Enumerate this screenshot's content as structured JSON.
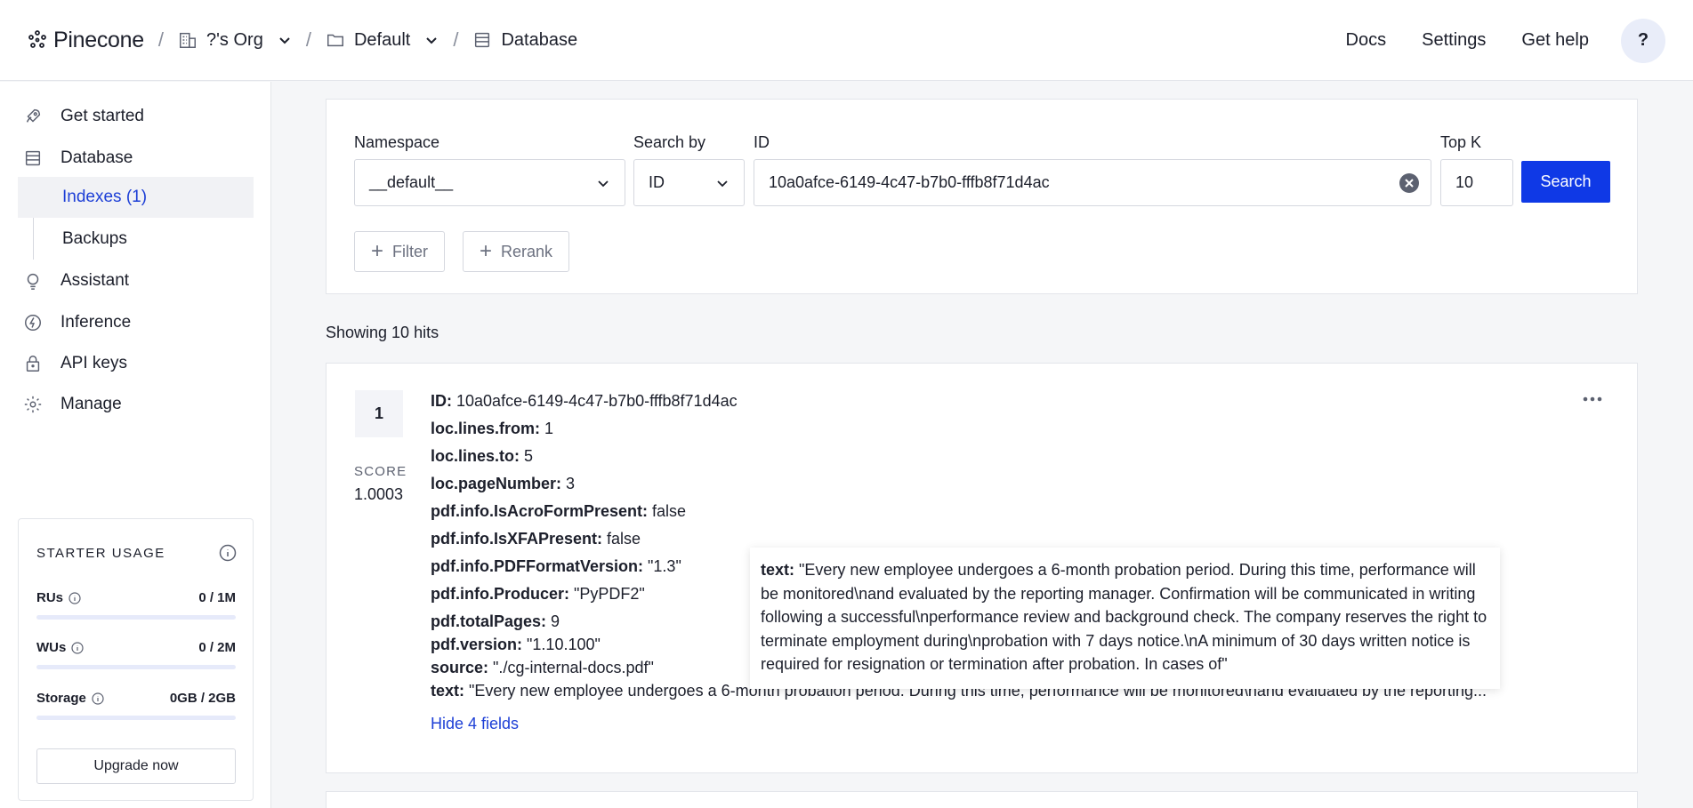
{
  "header": {
    "logo_text": "Pinecone",
    "breadcrumbs": [
      {
        "label": "?'s Org",
        "icon": "building-icon"
      },
      {
        "label": "Default",
        "icon": "folder-icon"
      },
      {
        "label": "Database",
        "icon": "database-icon"
      }
    ],
    "separator": "/",
    "nav": {
      "docs": "Docs",
      "settings": "Settings",
      "get_help": "Get help",
      "help_button": "?"
    }
  },
  "sidebar": {
    "items": [
      {
        "label": "Get started",
        "icon": "rocket-icon"
      },
      {
        "label": "Database",
        "icon": "database-icon"
      },
      {
        "label": "Assistant",
        "icon": "lightbulb-icon"
      },
      {
        "label": "Inference",
        "icon": "lightning-icon"
      },
      {
        "label": "API keys",
        "icon": "lock-icon"
      },
      {
        "label": "Manage",
        "icon": "gear-icon"
      }
    ],
    "sub_items": [
      {
        "label": "Indexes (1)",
        "active": true
      },
      {
        "label": "Backups",
        "active": false
      }
    ],
    "usage": {
      "title": "STARTER USAGE",
      "rows": [
        {
          "label": "RUs",
          "value": "0 / 1M",
          "fraction": 0
        },
        {
          "label": "WUs",
          "value": "0 / 2M",
          "fraction": 0
        },
        {
          "label": "Storage",
          "value": "0GB / 2GB",
          "fraction": 0
        }
      ],
      "upgrade_label": "Upgrade now"
    }
  },
  "search": {
    "namespace_label": "Namespace",
    "namespace_value": "__default__",
    "search_by_label": "Search by",
    "search_by_value": "ID",
    "id_label": "ID",
    "id_value": "10a0afce-6149-4c47-b7b0-fffb8f71d4ac",
    "topk_label": "Top K",
    "topk_value": "10",
    "search_button": "Search",
    "filter_button": "Filter",
    "rerank_button": "Rerank"
  },
  "results": {
    "count_text": "Showing 10 hits",
    "hit": {
      "rank": "1",
      "score_label": "SCORE",
      "score_value": "1.0003",
      "fields": [
        {
          "key": "ID:",
          "value": "10a0afce-6149-4c47-b7b0-fffb8f71d4ac"
        },
        {
          "key": "loc.lines.from:",
          "value": "1"
        },
        {
          "key": "loc.lines.to:",
          "value": "5"
        },
        {
          "key": "loc.pageNumber:",
          "value": "3"
        },
        {
          "key": "pdf.info.IsAcroFormPresent:",
          "value": "false"
        },
        {
          "key": "pdf.info.IsXFAPresent:",
          "value": "false"
        },
        {
          "key": "pdf.info.PDFFormatVersion:",
          "value": "\"1.3\""
        },
        {
          "key": "pdf.info.Producer:",
          "value": "\"PyPDF2\""
        },
        {
          "key": "pdf.totalPages:",
          "value": "9"
        },
        {
          "key": "pdf.version:",
          "value": "\"1.10.100\""
        },
        {
          "key": "source:",
          "value": "\"./cg-internal-docs.pdf\""
        },
        {
          "key": "text:",
          "value": "\"Every new employee undergoes a 6-month probation period. During this time, performance will be monitored\\nand evaluated by the reporting..."
        }
      ],
      "hide_fields_label": "Hide 4 fields",
      "tooltip": {
        "key": "text:",
        "value": "\"Every new employee undergoes a 6-month probation period. During this time, performance will be monitored\\nand evaluated by the reporting manager. Confirmation will be communicated in writing following a successful\\nperformance review and background check. The company reserves the right to terminate employment during\\nprobation with 7 days notice.\\nA minimum of 30 days written notice is required for resignation or termination after probation. In cases of\""
      }
    }
  }
}
